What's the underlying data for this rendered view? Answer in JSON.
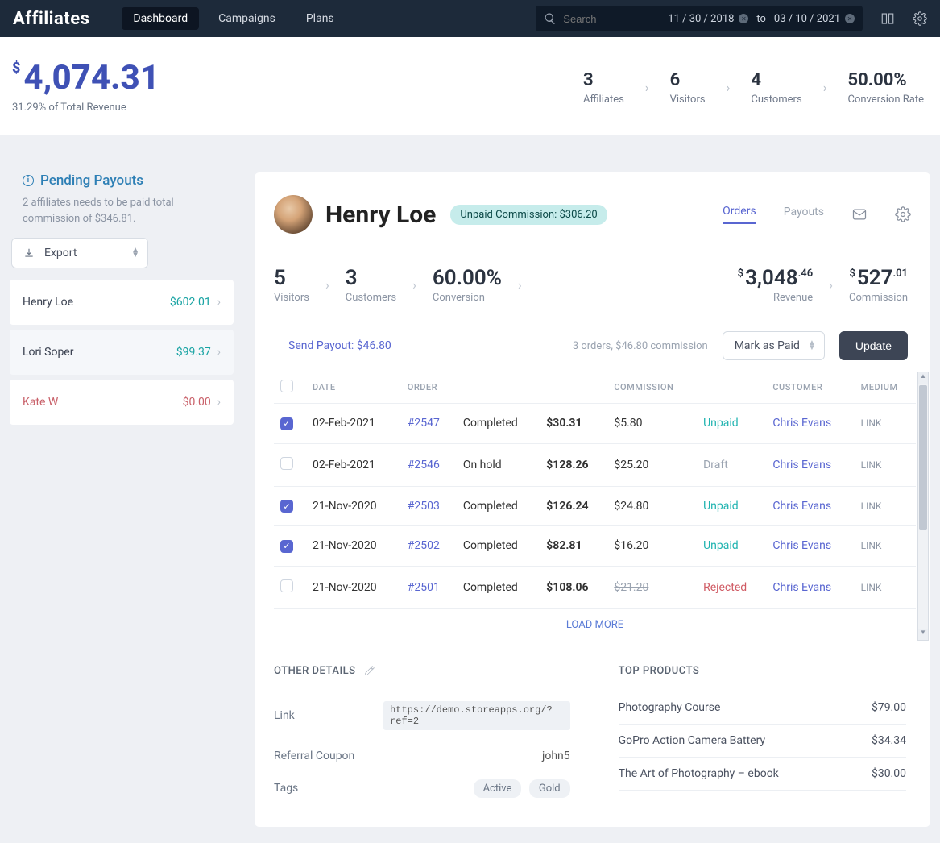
{
  "topbar": {
    "logo": "Affiliates",
    "nav": {
      "dashboard": "Dashboard",
      "campaigns": "Campaigns",
      "plans": "Plans"
    },
    "search_placeholder": "Search",
    "date_from": "11 / 30 / 2018",
    "date_to_label": "to",
    "date_to": "03 / 10 / 2021"
  },
  "summary": {
    "revenue_currency": "$",
    "revenue_amount": "4,074.31",
    "revenue_sub": "31.29% of Total Revenue",
    "kpis": {
      "affiliates": {
        "value": "3",
        "label": "Affiliates"
      },
      "visitors": {
        "value": "6",
        "label": "Visitors"
      },
      "customers": {
        "value": "4",
        "label": "Customers"
      },
      "conversion": {
        "value": "50.00%",
        "label": "Conversion Rate"
      }
    }
  },
  "sidebar": {
    "pending_title": "Pending Payouts",
    "pending_sub": "2 affiliates needs to be paid total commission of $346.81.",
    "export_label": "Export",
    "list": [
      {
        "name": "Henry Loe",
        "amount": "$602.01"
      },
      {
        "name": "Lori Soper",
        "amount": "$99.37"
      },
      {
        "name": "Kate W",
        "amount": "$0.00"
      }
    ]
  },
  "detail": {
    "name": "Henry Loe",
    "unpaid_badge": "Unpaid Commission: $306.20",
    "tabs": {
      "orders": "Orders",
      "payouts": "Payouts"
    },
    "kpis": {
      "visitors": {
        "value": "5",
        "label": "Visitors"
      },
      "customers": {
        "value": "3",
        "label": "Customers"
      },
      "conversion": {
        "value": "60.00%",
        "label": "Conversion"
      },
      "revenue": {
        "cur": "$",
        "whole": "3,048",
        "cents": ".46",
        "label": "Revenue"
      },
      "commission": {
        "cur": "$",
        "whole": "527",
        "cents": ".01",
        "label": "Commission"
      }
    },
    "send_payout": "Send Payout: $46.80",
    "orders_summary": "3 orders, $46.80 commission",
    "mark_as_paid": "Mark as Paid",
    "update_btn": "Update",
    "columns": {
      "date": "DATE",
      "order": "ORDER",
      "commission": "COMMISSION",
      "customer": "CUSTOMER",
      "medium": "MEDIUM"
    },
    "rows": [
      {
        "checked": true,
        "date": "02-Feb-2021",
        "order": "#2547",
        "order_status": "Completed",
        "order_total": "$30.31",
        "commission": "$5.80",
        "cstatus": "Unpaid",
        "customer": "Chris Evans",
        "medium": "LINK"
      },
      {
        "checked": false,
        "date": "02-Feb-2021",
        "order": "#2546",
        "order_status": "On hold",
        "order_total": "$128.26",
        "commission": "$25.20",
        "cstatus": "Draft",
        "customer": "Chris Evans",
        "medium": "LINK"
      },
      {
        "checked": true,
        "date": "21-Nov-2020",
        "order": "#2503",
        "order_status": "Completed",
        "order_total": "$126.24",
        "commission": "$24.80",
        "cstatus": "Unpaid",
        "customer": "Chris Evans",
        "medium": "LINK"
      },
      {
        "checked": true,
        "date": "21-Nov-2020",
        "order": "#2502",
        "order_status": "Completed",
        "order_total": "$82.81",
        "commission": "$16.20",
        "cstatus": "Unpaid",
        "customer": "Chris Evans",
        "medium": "LINK"
      },
      {
        "checked": false,
        "date": "21-Nov-2020",
        "order": "#2501",
        "order_status": "Completed",
        "order_total": "$108.06",
        "commission": "$21.20",
        "cstatus": "Rejected",
        "customer": "Chris Evans",
        "medium": "LINK"
      }
    ],
    "load_more": "LOAD MORE",
    "other_details": {
      "heading": "OTHER DETAILS",
      "link_label": "Link",
      "link_value": "https://demo.storeapps.org/?ref=2",
      "coupon_label": "Referral Coupon",
      "coupon_value": "john5",
      "tags_label": "Tags",
      "tag1": "Active",
      "tag2": "Gold"
    },
    "top_products": {
      "heading": "TOP PRODUCTS",
      "rows": [
        {
          "name": "Photography Course",
          "price": "$79.00"
        },
        {
          "name": "GoPro Action Camera Battery",
          "price": "$34.34"
        },
        {
          "name": "The Art of Photography – ebook",
          "price": "$30.00"
        }
      ]
    }
  }
}
